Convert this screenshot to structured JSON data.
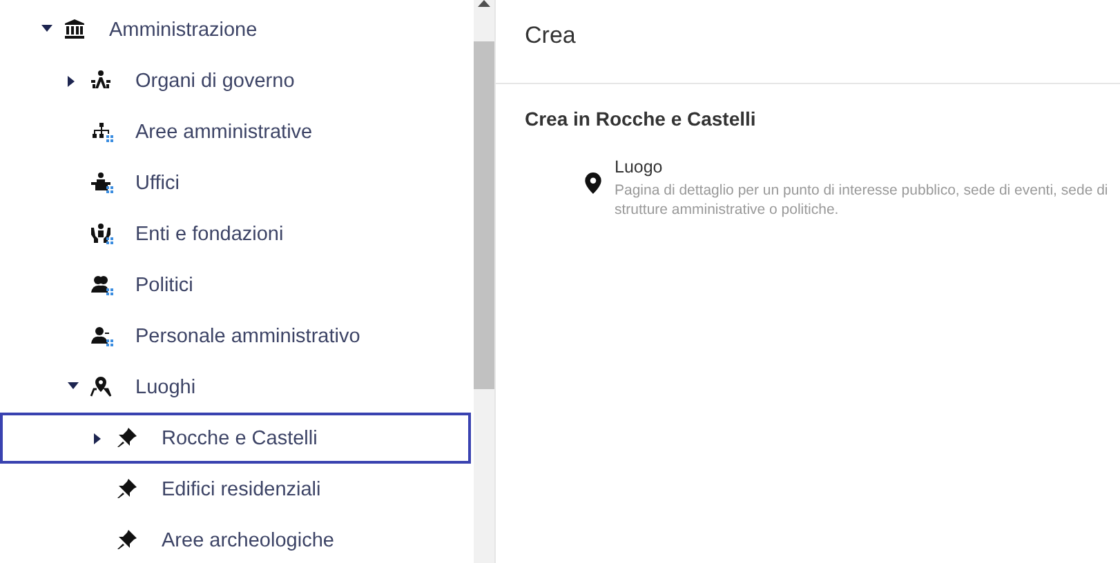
{
  "tree": [
    {
      "label": "Amministrazione",
      "kind": "institution",
      "expanded": true,
      "selected": false,
      "children": [
        {
          "label": "Organi di governo",
          "kind": "governance",
          "expanded": false,
          "selected": false
        },
        {
          "label": "Aree amministrative",
          "kind": "org-chart",
          "selected": false
        },
        {
          "label": "Uffici",
          "kind": "desk",
          "selected": false
        },
        {
          "label": "Enti e fondazioni",
          "kind": "hands",
          "selected": false
        },
        {
          "label": "Politici",
          "kind": "people",
          "selected": false
        },
        {
          "label": "Personale amministrativo",
          "kind": "person",
          "selected": false
        },
        {
          "label": "Luoghi",
          "kind": "map-pin",
          "expanded": true,
          "selected": false,
          "children": [
            {
              "label": "Rocche e Castelli",
              "kind": "pushpin",
              "expanded": false,
              "selected": true
            },
            {
              "label": "Edifici residenziali",
              "kind": "pushpin",
              "selected": false
            },
            {
              "label": "Aree archeologiche",
              "kind": "pushpin",
              "selected": false
            }
          ]
        }
      ]
    }
  ],
  "panel": {
    "title": "Crea",
    "section_title": "Crea in Rocche e Castelli",
    "options": [
      {
        "title": "Luogo",
        "description": "Pagina di dettaglio per un punto di interesse pubblico, sede di eventi, sede di strutture amministrative o politiche.",
        "kind": "marker"
      }
    ]
  }
}
